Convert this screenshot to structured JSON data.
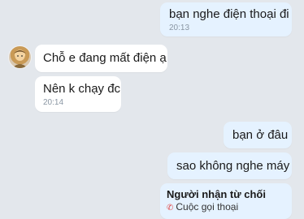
{
  "messages": [
    {
      "id": "m1",
      "text": "bạn nghe điện thoại đi",
      "time": "20:13"
    },
    {
      "id": "m2",
      "text": "Chỗ e đang mất điện ạ",
      "time": ""
    },
    {
      "id": "m3",
      "text": "Nên k chạy đc",
      "time": "20:14"
    },
    {
      "id": "m4",
      "text": "bạn ở đâu",
      "time": ""
    },
    {
      "id": "m5",
      "text": "sao không nghe máy",
      "time": ""
    }
  ],
  "call_card": {
    "title": "Người nhận từ chối",
    "subtitle": "Cuộc gọi thoại"
  }
}
